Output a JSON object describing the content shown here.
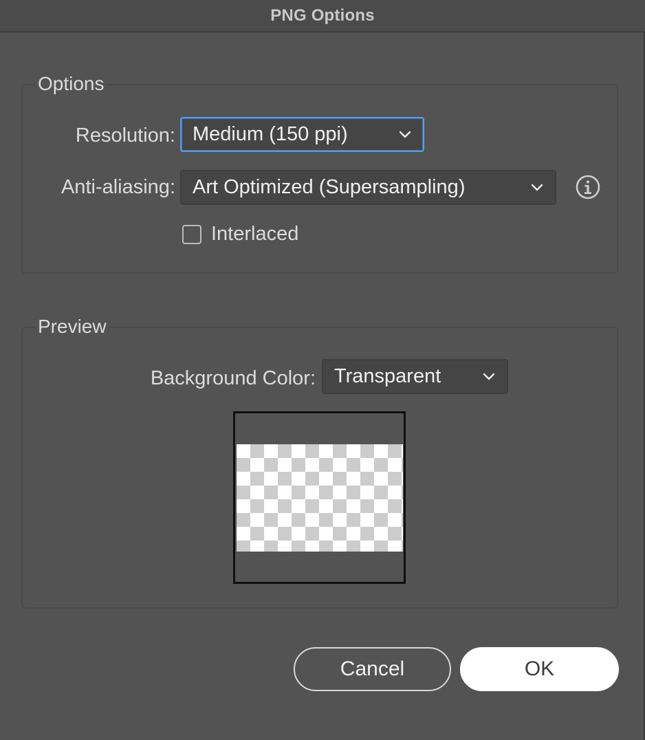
{
  "window": {
    "title": "PNG Options"
  },
  "options_group": {
    "legend": "Options",
    "resolution": {
      "label": "Resolution:",
      "value": "Medium (150 ppi)"
    },
    "antialiasing": {
      "label": "Anti-aliasing:",
      "value": "Art Optimized (Supersampling)"
    },
    "interlaced": {
      "label": "Interlaced",
      "checked": false
    }
  },
  "preview_group": {
    "legend": "Preview",
    "background_color": {
      "label": "Background Color:",
      "value": "Transparent"
    }
  },
  "buttons": {
    "cancel": "Cancel",
    "ok": "OK"
  },
  "colors": {
    "accent": "#5b9bea",
    "background": "#535353"
  },
  "icons": {
    "dropdown": "chevron-down-icon",
    "info": "info-icon"
  }
}
